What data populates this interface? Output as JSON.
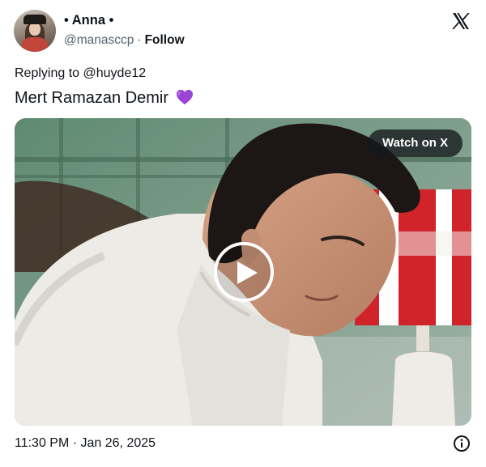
{
  "author": {
    "display_name": "Anna",
    "name_decoration": "•",
    "handle": "@manasccp",
    "separator": "·",
    "follow_label": "Follow"
  },
  "platform_logo": "x-logo-icon",
  "reply": {
    "prefix": "Replying to",
    "target": "@huyde12"
  },
  "tweet": {
    "text": "Mert Ramazan Demir",
    "emoji_icon": "purple-heart-icon",
    "emoji_color": "#9b45d6"
  },
  "media": {
    "watch_label": "Watch on X",
    "play_icon": "play-icon"
  },
  "timestamp": "11:30 PM · Jan 26, 2025",
  "info_icon": "info-icon"
}
